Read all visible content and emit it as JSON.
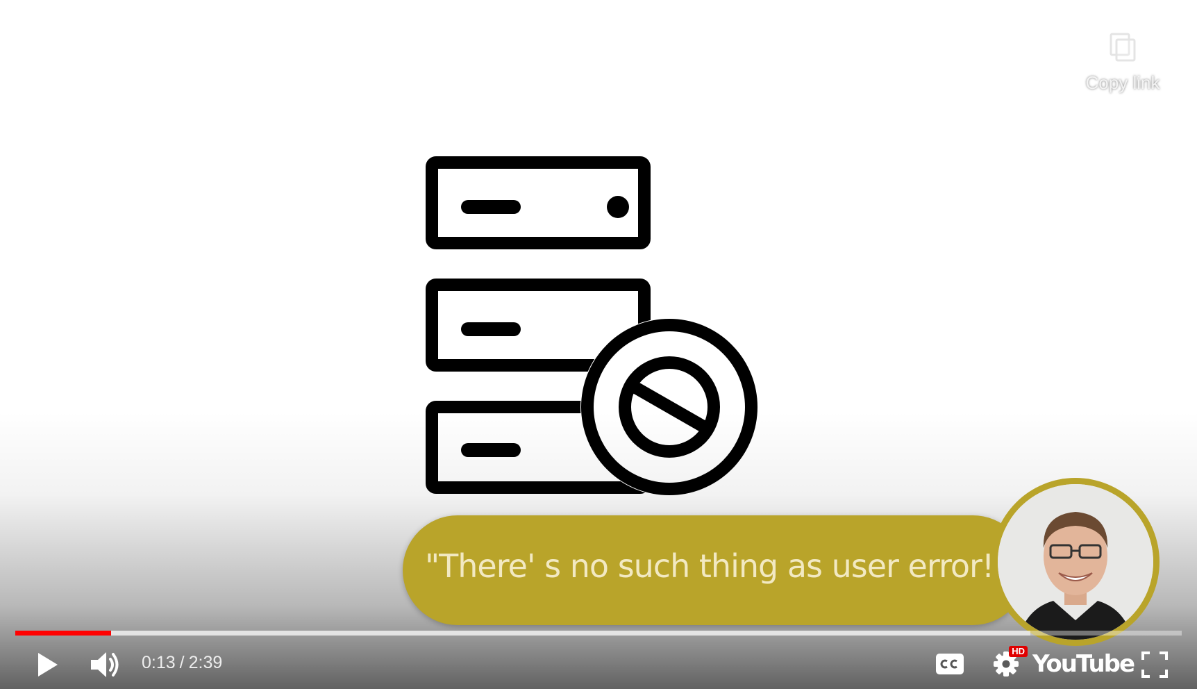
{
  "overlay": {
    "copy_link_label": "Copy link"
  },
  "video": {
    "quote": "\"There' s no such thing as user error!\""
  },
  "progress": {
    "played_fraction": 0.082,
    "loaded_fraction": 0.87
  },
  "controls": {
    "current_time": "0:13",
    "separator": "/",
    "duration": "2:39",
    "hd_badge": "HD",
    "logo_text": "YouTube"
  },
  "icons": {
    "copy": "copy-icon",
    "play": "play-icon",
    "volume": "volume-icon",
    "captions": "captions-icon",
    "settings": "gear-icon",
    "fullscreen": "fullscreen-icon"
  },
  "colors": {
    "progress_played": "#ff0000",
    "banner": "#b9a42a",
    "banner_text": "#f2e9c2"
  }
}
